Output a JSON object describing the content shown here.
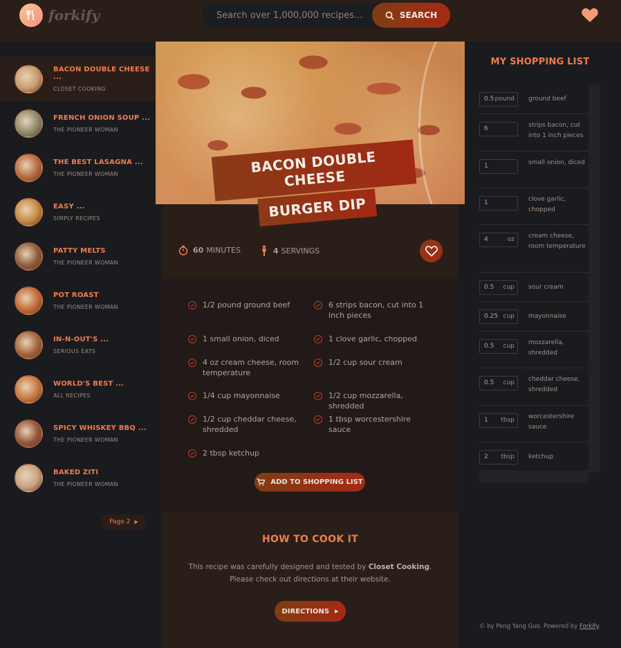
{
  "header": {
    "logo_text": "forkify",
    "search_placeholder": "Search over 1,000,000 recipes...",
    "search_button": "SEARCH"
  },
  "results": [
    {
      "title": "BACON DOUBLE CHEESE ...",
      "publisher": "CLOSET COOKING",
      "active": true,
      "thumb_color": "#c79c6e"
    },
    {
      "title": "FRENCH ONION SOUP ...",
      "publisher": "THE PIONEER WOMAN",
      "thumb_color": "#8b8a6a"
    },
    {
      "title": "THE BEST LASAGNA ...",
      "publisher": "THE PIONEER WOMAN",
      "thumb_color": "#b56a3c"
    },
    {
      "title": "EASY ...",
      "publisher": "SIMPLY RECIPES",
      "thumb_color": "#c48a42"
    },
    {
      "title": "PATTY MELTS",
      "publisher": "THE PIONEER WOMAN",
      "thumb_color": "#8e5a3a"
    },
    {
      "title": "POT ROAST",
      "publisher": "THE PIONEER WOMAN",
      "thumb_color": "#c36a34"
    },
    {
      "title": "IN-N-OUT'S ...",
      "publisher": "SERIOUS EATS",
      "thumb_color": "#a5633a"
    },
    {
      "title": "WORLD'S BEST ...",
      "publisher": "ALL RECIPES",
      "thumb_color": "#c8783e"
    },
    {
      "title": "SPICY WHISKEY BBQ ...",
      "publisher": "THE PIONEER WOMAN",
      "thumb_color": "#93533a"
    },
    {
      "title": "BAKED ZITI",
      "publisher": "THE PIONEER WOMAN",
      "thumb_color": "#c9a281"
    }
  ],
  "pagination": {
    "next_label": "Page 2"
  },
  "recipe": {
    "title_line1": "BACON DOUBLE CHEESE",
    "title_line2": "BURGER DIP",
    "minutes": "60",
    "minutes_label": "MINUTES",
    "servings": "4",
    "servings_label": "SERVINGS",
    "ingredients": [
      {
        "text": "1/2 pound ground beef"
      },
      {
        "text": "6 strips bacon, cut into 1 inch pieces"
      },
      {
        "text": "1 small onion, diced"
      },
      {
        "text": "1 clove garlic, chopped"
      },
      {
        "text": "4 oz cream cheese, room temperature"
      },
      {
        "text": "1/2 cup sour cream"
      },
      {
        "text": "1/4 cup mayonnaise"
      },
      {
        "text": "1/2 cup mozzarella, shredded"
      },
      {
        "text": "1/2 cup cheddar cheese, shredded"
      },
      {
        "text": "1 tbsp worcestershire sauce"
      },
      {
        "text": "2 tbsp ketchup"
      }
    ],
    "add_button": "ADD TO SHOPPING LIST",
    "how_title": "HOW TO COOK IT",
    "how_text_1": "This recipe was carefully designed and tested by ",
    "how_publisher": "Closet Cooking",
    "how_text_2": ". Please check out directions at their website.",
    "directions_button": "DIRECTIONS"
  },
  "shopping": {
    "title": "MY SHOPPING LIST",
    "items": [
      {
        "count": "0.5",
        "unit": "pound",
        "desc": "ground beef"
      },
      {
        "count": "6",
        "unit": "",
        "desc": "strips bacon, cut into 1 inch pieces"
      },
      {
        "count": "1",
        "unit": "",
        "desc": "small onion, diced"
      },
      {
        "count": "1",
        "unit": "",
        "desc": "clove garlic, chopped"
      },
      {
        "count": "4",
        "unit": "oz",
        "desc": "cream cheese, room temperature"
      },
      {
        "count": "0.5",
        "unit": "cup",
        "desc": "sour cream"
      },
      {
        "count": "0.25",
        "unit": "cup",
        "desc": "mayonnaise"
      },
      {
        "count": "0.5",
        "unit": "cup",
        "desc": "mozzarella, shredded"
      },
      {
        "count": "0.5",
        "unit": "cup",
        "desc": "cheddar cheese, shredded"
      },
      {
        "count": "1",
        "unit": "tbsp",
        "desc": "worcestershire sauce"
      },
      {
        "count": "2",
        "unit": "tbsp",
        "desc": "ketchup"
      }
    ]
  },
  "footer": {
    "text": "© by Peng Yang Guo. Powered by ",
    "link": "Forkify",
    "end": "."
  },
  "colors": {
    "accent": "#f07c4e",
    "button_start": "#7e3d12",
    "button_end": "#a52a16",
    "header_bg": "#2a1e19"
  }
}
